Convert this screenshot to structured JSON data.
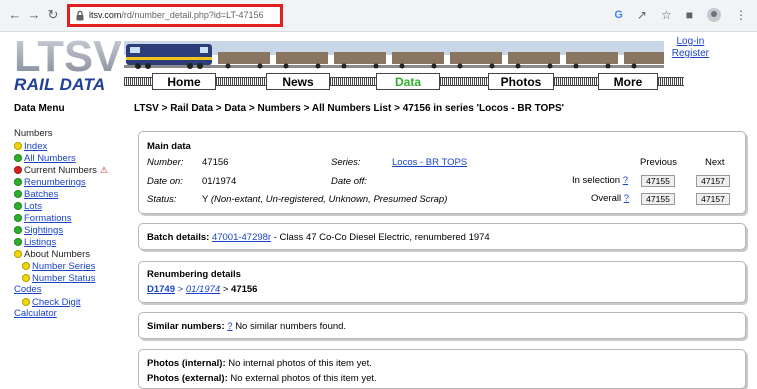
{
  "browser": {
    "url_host": "ltsv.com",
    "url_path": "/rd/number_detail.php?id=LT-47156"
  },
  "site": {
    "logo_text": "LTSV",
    "brand": "RAIL DATA",
    "login": "Log-in",
    "register": "Register",
    "menu": [
      "Home",
      "News",
      "Data",
      "Photos",
      "More"
    ],
    "active_menu": "Data"
  },
  "sidebar": {
    "heading": "Data Menu",
    "numbers_label": "Numbers",
    "items": [
      {
        "label": "Index",
        "dot": "#f2d600",
        "link": true
      },
      {
        "label": "All Numbers",
        "dot": "#2ab02a",
        "link": true
      },
      {
        "label": "Current Numbers",
        "dot": "#d81f1f",
        "link": false,
        "warn": "⚠"
      },
      {
        "label": "Renumberings",
        "dot": "#2ab02a",
        "link": true
      },
      {
        "label": "Batches",
        "dot": "#2ab02a",
        "link": true
      },
      {
        "label": "Lots",
        "dot": "#2ab02a",
        "link": true
      },
      {
        "label": "Formations",
        "dot": "#2ab02a",
        "link": true
      },
      {
        "label": "Sightings",
        "dot": "#2ab02a",
        "link": true
      },
      {
        "label": "Listings",
        "dot": "#2ab02a",
        "link": true
      },
      {
        "label": "About Numbers",
        "dot": "#f2d600",
        "link": false
      },
      {
        "label": "Number Series",
        "dot": "#f2d600",
        "link": true,
        "indent": true
      },
      {
        "label": "Number Status",
        "dot": "#f2d600",
        "link": true,
        "indent": true
      }
    ],
    "codes": "Codes",
    "check_digit": "Check Digit",
    "calculator": "Calculator"
  },
  "breadcrumb": "LTSV > Rail Data > Data > Numbers > All Numbers List > 47156 in series 'Locos - BR TOPS'",
  "main": {
    "title": "Main data",
    "number_label": "Number:",
    "number": "47156",
    "series_label": "Series:",
    "series": "Locos - BR TOPS",
    "date_on_label": "Date on:",
    "date_on": "01/1974",
    "date_off_label": "Date off:",
    "status_label": "Status:",
    "status_code": "Y",
    "status_detail": "(Non-extant, Un-registered, Unknown, Presumed Scrap)",
    "previous_label": "Previous",
    "next_label": "Next",
    "in_selection_label": "In selection",
    "overall_label": "Overall",
    "help": "?",
    "sel_prev": "47155",
    "sel_next": "47157",
    "all_prev": "47155",
    "all_next": "47157"
  },
  "batch": {
    "label": "Batch details:",
    "link": "47001-47298r",
    "text": "- Class 47 Co-Co Diesel Electric, renumbered 1974"
  },
  "renumbering": {
    "title": "Renumbering details",
    "from": "D1749",
    "sep1": ">",
    "date": "01/1974",
    "sep2": ">",
    "to": "47156"
  },
  "similar": {
    "label": "Similar numbers:",
    "help": "?",
    "text": "No similar numbers found."
  },
  "photos": {
    "internal_label": "Photos (internal):",
    "internal_text": "No internal photos of this item yet.",
    "external_label": "Photos (external):",
    "external_text": "No external photos of this item yet."
  },
  "colors": {
    "link": "#1a44c8",
    "active_menu": "#2db02d",
    "highlight_box": "#e0201f",
    "brand": "#1f3f99"
  }
}
